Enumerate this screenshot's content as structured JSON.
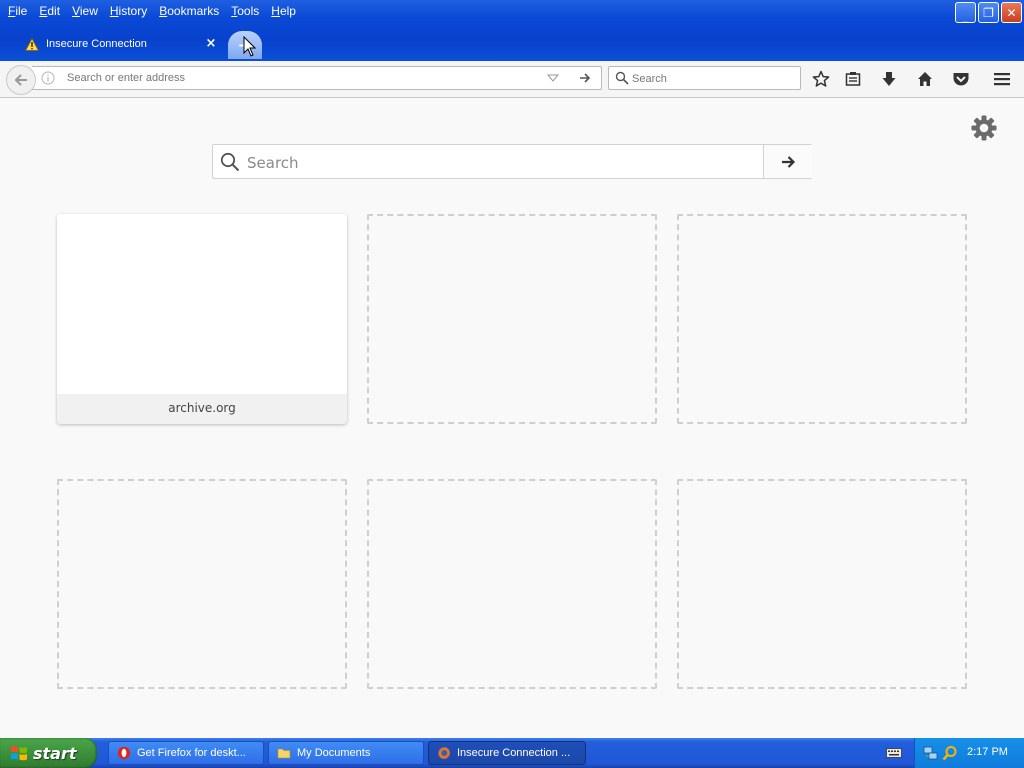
{
  "window": {
    "menu": [
      "File",
      "Edit",
      "View",
      "History",
      "Bookmarks",
      "Tools",
      "Help"
    ],
    "controls": {
      "minimize": "_",
      "restore": "❐",
      "close": "✕"
    }
  },
  "tabs": {
    "active_title": "Insecure Connection",
    "close_glyph": "×",
    "new_tab_glyph": "+"
  },
  "navbar": {
    "url_placeholder": "Search or enter address",
    "search_placeholder": "Search"
  },
  "newtab": {
    "search_placeholder": "Search",
    "tiles": [
      {
        "label": "archive.org",
        "filled": true
      },
      {
        "label": "",
        "filled": false
      },
      {
        "label": "",
        "filled": false
      },
      {
        "label": "",
        "filled": false
      },
      {
        "label": "",
        "filled": false
      },
      {
        "label": "",
        "filled": false
      }
    ]
  },
  "taskbar": {
    "start_label": "start",
    "tasks": [
      {
        "label": "Get Firefox for deskt...",
        "icon": "opera-icon"
      },
      {
        "label": "My Documents",
        "icon": "folder-icon"
      },
      {
        "label": "Insecure Connection ...",
        "icon": "firefox-icon",
        "active": true
      }
    ],
    "clock": "2:17 PM"
  },
  "colors": {
    "xp_blue": "#0a49d6",
    "start_green": "#3a8d3a",
    "tray_blue": "#0f7bdc",
    "page_bg": "#f9f9fa"
  }
}
